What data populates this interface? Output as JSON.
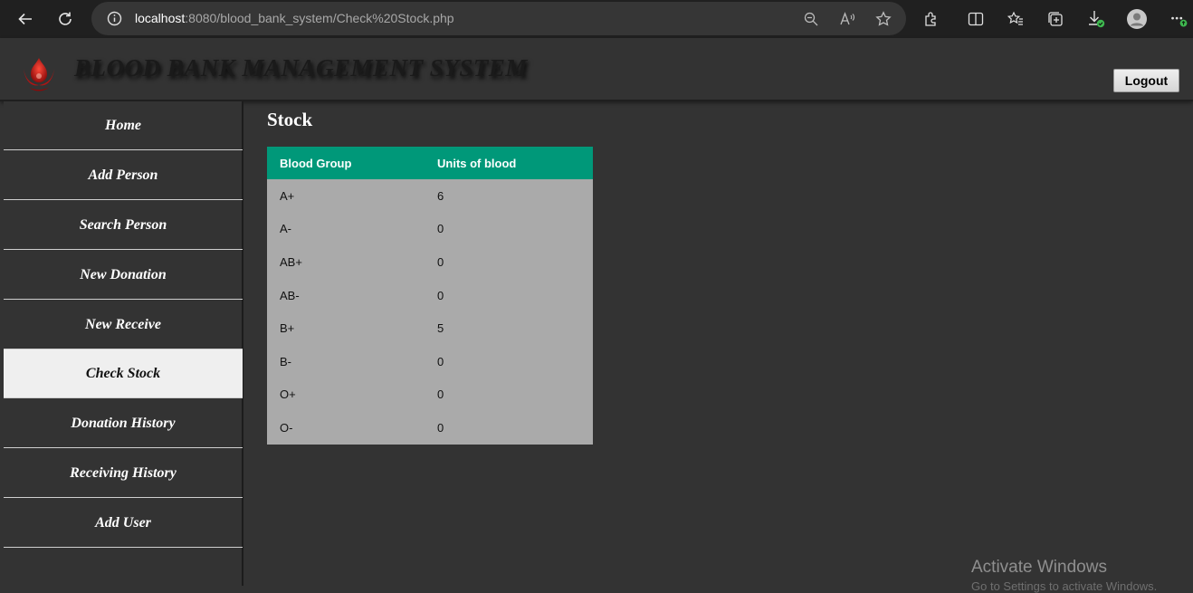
{
  "browser": {
    "url_host": "localhost",
    "url_rest": ":8080/blood_bank_system/Check%20Stock.php"
  },
  "header": {
    "title": "BLOOD BANK MANAGEMENT SYSTEM",
    "logout_label": "Logout"
  },
  "sidebar": {
    "items": [
      {
        "label": "Home"
      },
      {
        "label": "Add Person"
      },
      {
        "label": "Search Person"
      },
      {
        "label": "New Donation"
      },
      {
        "label": "New Receive"
      },
      {
        "label": "Check Stock"
      },
      {
        "label": "Donation History"
      },
      {
        "label": "Receiving History"
      },
      {
        "label": "Add User"
      }
    ],
    "active": "Check Stock"
  },
  "main": {
    "title": "Stock",
    "table": {
      "columns": [
        "Blood Group",
        "Units of blood"
      ],
      "rows": [
        [
          "A+",
          "6"
        ],
        [
          "A-",
          "0"
        ],
        [
          "AB+",
          "0"
        ],
        [
          "AB-",
          "0"
        ],
        [
          "B+",
          "5"
        ],
        [
          "B-",
          "0"
        ],
        [
          "O+",
          "0"
        ],
        [
          "O-",
          "0"
        ]
      ]
    }
  },
  "watermark": {
    "title": "Activate Windows",
    "subtitle": "Go to Settings to activate Windows."
  },
  "colors": {
    "table_header": "#009879",
    "table_row": "#aaaaaa",
    "page_background": "#333333",
    "sidebar_active": "#efefef"
  }
}
